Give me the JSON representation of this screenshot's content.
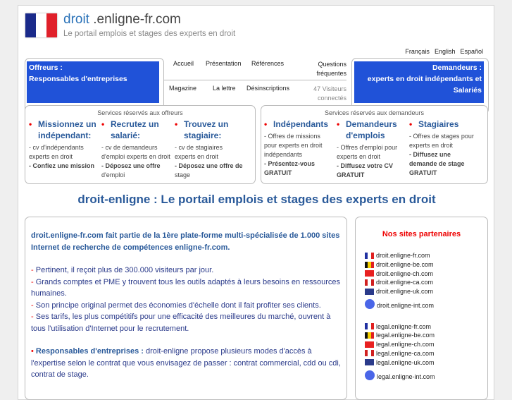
{
  "header": {
    "title_bold": "droit",
    "title_rest": " .enligne-fr.com",
    "subtitle": "Le portail emplois et stages des experts en droit",
    "flag": "france-flag-icon"
  },
  "languages": [
    "Français",
    "English",
    "Español"
  ],
  "offreurs_box": {
    "line1": "Offreurs :",
    "line2": "Responsables d'entreprises"
  },
  "demandeurs_box": {
    "line1": "Demandeurs :",
    "line2": "experts en droit indépendants et",
    "line3": "Salariés"
  },
  "nav": {
    "accueil": "Accueil",
    "presentation": "Présentation",
    "references": "Références",
    "faq1": "Questions",
    "faq2": "fréquentes",
    "magazine": "Magazine",
    "lettre": "La lettre",
    "desinscriptions": "Désinscriptions",
    "visitors1": "47 Visiteurs",
    "visitors2": "connectés"
  },
  "services_offreurs": {
    "title": "Services réservés aux offreurs",
    "cols": [
      {
        "h1": "Missionnez un",
        "h2": "indépendant:",
        "l1": "- cv d'indépendants",
        "l2": "experts en droit",
        "l3": "- Confiez une mission",
        "l4": ""
      },
      {
        "h1": "Recrutez un",
        "h2": "salarié:",
        "l1": "- cv de demandeurs",
        "l2": "d'emploi experts en droit",
        "l3": "- Déposez une offre",
        "l4": "d'emploi"
      },
      {
        "h1": "Trouvez un",
        "h2": "stagiaire:",
        "l1": "- cv de stagiaires",
        "l2": "experts en droit",
        "l3": "- Déposez une offre de",
        "l4": "stage"
      }
    ]
  },
  "services_demandeurs": {
    "title": "Services réservés aux demandeurs",
    "cols": [
      {
        "h1": "Indépendants",
        "h2": "",
        "l1": "- Offres de missions",
        "l2": "pour experts en droit",
        "l3": "indépendants",
        "l4": "- Présentez-vous",
        "l5": "GRATUIT"
      },
      {
        "h1": "Demandeurs",
        "h2": "d'emplois",
        "l1": "- Offres d'emploi pour",
        "l2": "experts en droit",
        "l3": "",
        "l4": "- Diffusez votre CV",
        "l5": "GRATUIT"
      },
      {
        "h1": "Stagiaires",
        "h2": "",
        "l1": "- Offres de stages pour",
        "l2": "experts en droit",
        "l3": "",
        "l4": "- Diffusez une",
        "l5": "demande de stage",
        "l6": "GRATUIT"
      }
    ]
  },
  "heading": "droit-enligne : Le portail emplois et stages des experts en droit",
  "main": {
    "intro": "droit.enligne-fr.com fait partie de la 1ère plate-forme multi-spécialisée de 1.000 sites Internet de recherche de compétences enligne-fr.com.",
    "bullets": [
      "Pertinent, il reçoit plus de 300.000 visiteurs par jour.",
      "Grands comptes et PME y trouvent tous les outils adaptés à leurs besoins en ressources humaines.",
      "Son principe original permet des économies d'échelle dont il fait profiter ses clients.",
      "Ses tarifs, les plus compétitifs pour une efficacité des meilleures du marché, ouvrent à tous l'utilisation d'Internet pour le recrutement."
    ],
    "resp_label": "Responsables d'entreprises :",
    "resp_text": " droit-enligne propose plusieurs modes d'accès à l'expertise selon le contrat que vous envisagez de passer : contrat commercial, cdd ou cdi, contrat de stage."
  },
  "partners": {
    "title": "Nos sites partenaires",
    "droit": [
      "droit.enligne-fr.com",
      "droit.enligne-be.com",
      "droit.enligne-ch.com",
      "droit.enligne-ca.com",
      "droit.enligne-uk.com",
      "droit.enligne-int.com"
    ],
    "legal": [
      "legal.enligne-fr.com",
      "legal.enligne-be.com",
      "legal.enligne-ch.com",
      "legal.enligne-ca.com",
      "legal.enligne-uk.com",
      "legal.enligne-int.com"
    ]
  }
}
